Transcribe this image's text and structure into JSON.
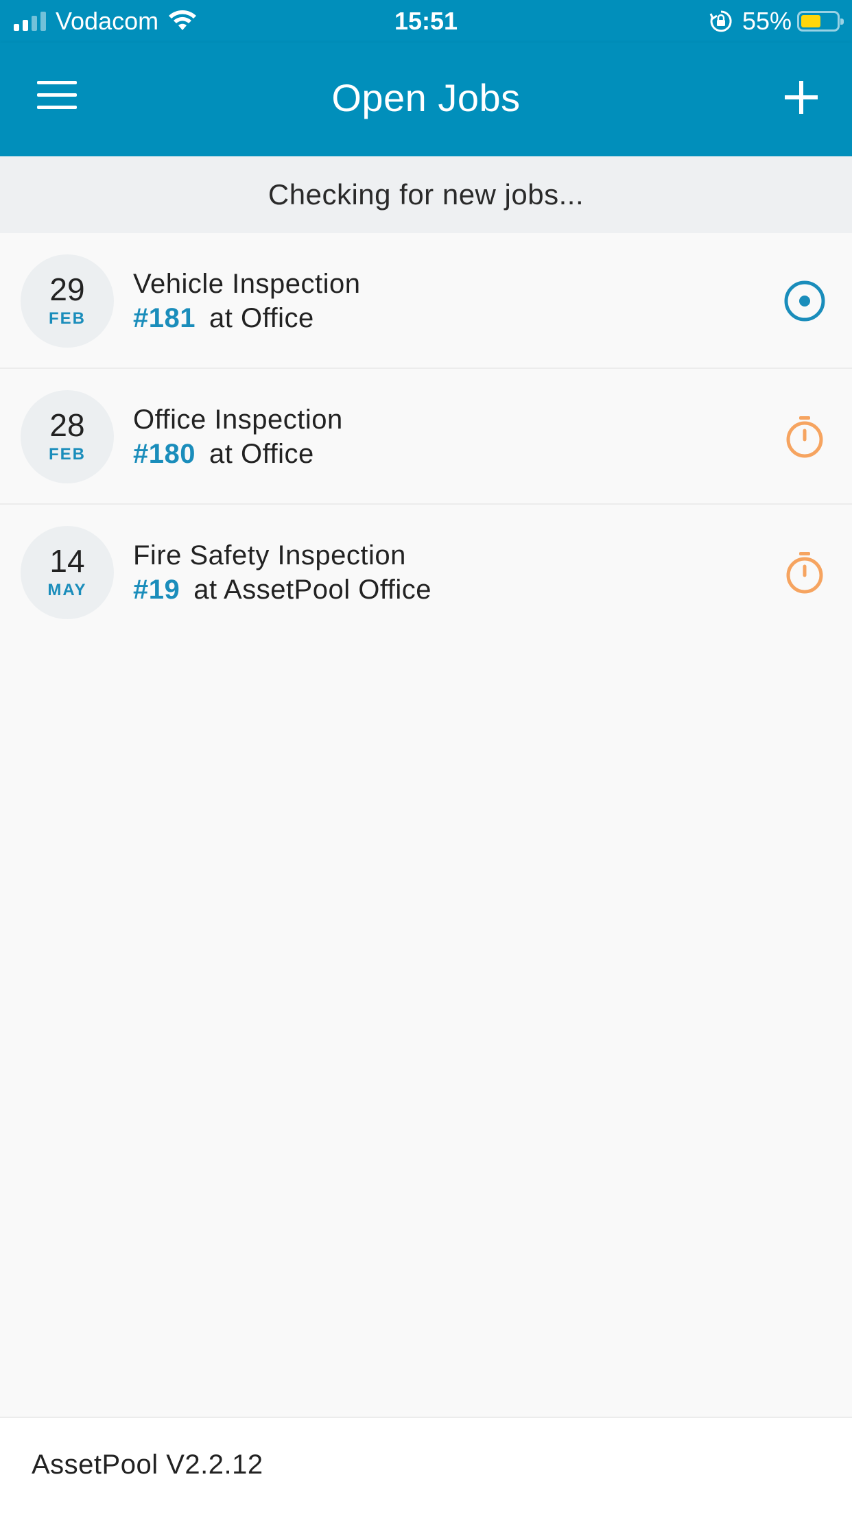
{
  "status_bar": {
    "carrier": "Vodacom",
    "time": "15:51",
    "battery_percent": "55%",
    "battery_level": 0.55,
    "battery_color": "#ffd60a",
    "icons": [
      "signal-icon",
      "wifi-icon",
      "rotation-lock-icon",
      "battery-icon"
    ]
  },
  "header": {
    "title": "Open Jobs",
    "menu_icon": "hamburger-menu-icon",
    "add_icon": "plus-icon",
    "brand_color": "#018fbb"
  },
  "banner": {
    "text": "Checking for new jobs..."
  },
  "jobs": [
    {
      "day": "29",
      "month": "FEB",
      "title": "Vehicle Inspection",
      "number": "#181",
      "location": "at Office",
      "status_icon": "in-progress-target-icon",
      "status_color": "#1a8dbb"
    },
    {
      "day": "28",
      "month": "FEB",
      "title": "Office Inspection",
      "number": "#180",
      "location": "at Office",
      "status_icon": "stopwatch-icon",
      "status_color": "#f6a460"
    },
    {
      "day": "14",
      "month": "MAY",
      "title": "Fire Safety Inspection",
      "number": "#19",
      "location": "at AssetPool Office",
      "status_icon": "stopwatch-icon",
      "status_color": "#f6a460"
    }
  ],
  "footer": {
    "version": "AssetPool V2.2.12"
  }
}
